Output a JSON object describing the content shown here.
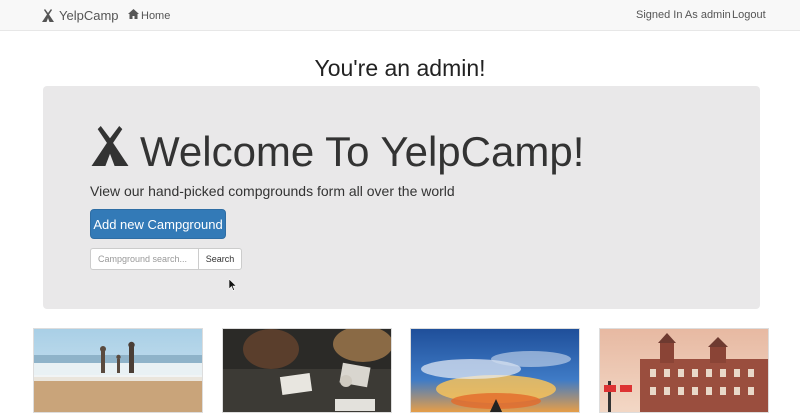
{
  "navbar": {
    "brand": "YelpCamp",
    "home": "Home",
    "signed_in": "Signed In As admin",
    "logout": "Logout"
  },
  "admin_heading": "You're an admin!",
  "jumbotron": {
    "title": "Welcome To YelpCamp!",
    "subtitle": "View our hand-picked compgrounds form all over the world",
    "add_button": "Add new Campground",
    "search": {
      "placeholder": "Campground search...",
      "button": "Search"
    }
  },
  "campgrounds": [
    {
      "image": "beach-family-photo"
    },
    {
      "image": "people-reading-at-table-photo"
    },
    {
      "image": "sunset-clouds-photo"
    },
    {
      "image": "brick-building-photo"
    }
  ],
  "colors": {
    "primary": "#337ab7",
    "navbar_bg": "#f8f8f8",
    "jumbotron_bg": "#e9e8e9"
  }
}
